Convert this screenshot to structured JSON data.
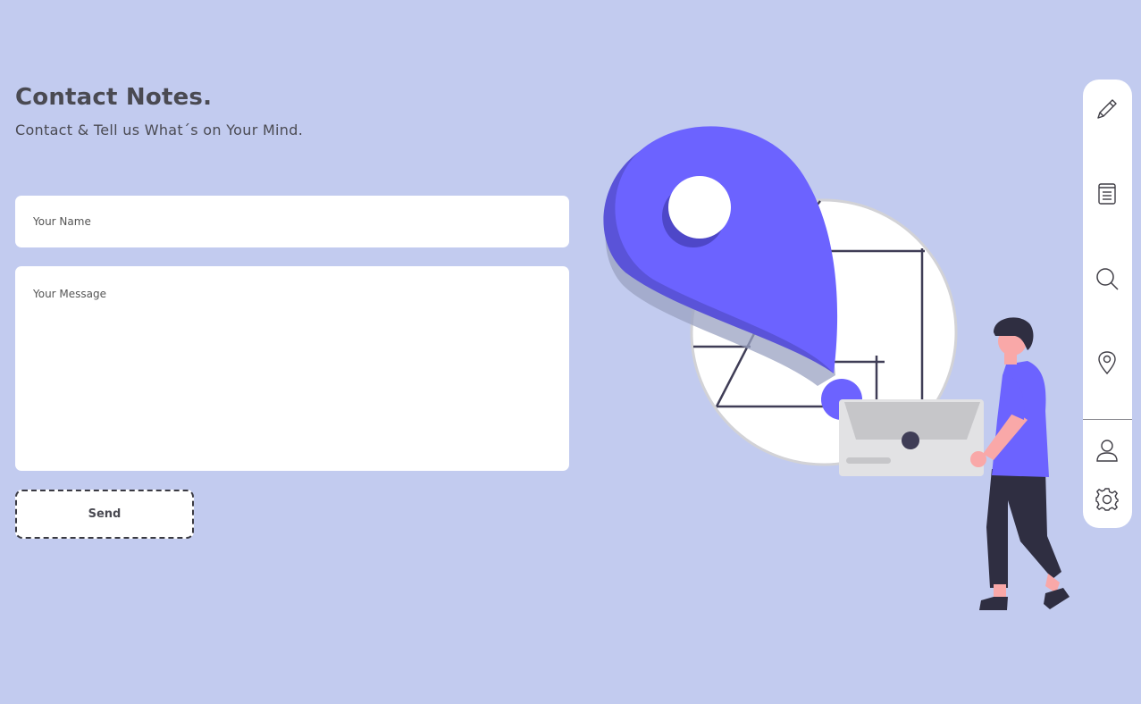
{
  "header": {
    "title": "Contact Notes.",
    "subtitle": "Contact & Tell us What´s on Your Mind."
  },
  "form": {
    "name_placeholder": "Your Name",
    "name_value": "",
    "message_placeholder": "Your Message",
    "message_value": "",
    "send_label": "Send"
  },
  "sidebar": {
    "items": [
      {
        "icon": "pencil-icon"
      },
      {
        "icon": "notes-icon"
      },
      {
        "icon": "search-icon"
      },
      {
        "icon": "location-pin-icon"
      },
      {
        "icon": "user-icon"
      },
      {
        "icon": "gear-icon"
      }
    ]
  },
  "colors": {
    "background": "#c2cbef",
    "accent": "#6c63ff",
    "text": "#4a4a52",
    "skin": "#f9a8a8",
    "dark": "#2f2e41"
  }
}
